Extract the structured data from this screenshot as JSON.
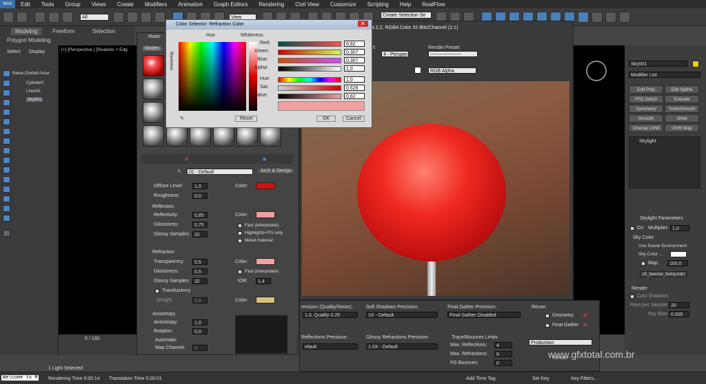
{
  "menubar": {
    "app_logo": "MAX",
    "items": [
      "Edit",
      "Tools",
      "Group",
      "Views",
      "Create",
      "Modifiers",
      "Animation",
      "Graph Editors",
      "Rendering",
      "Civil View",
      "Customize",
      "Scripting",
      "Help",
      "RealFlow"
    ]
  },
  "toolbar": {
    "selection_filter": "All",
    "ref_coord": "View",
    "named_selection": "Create Selection Se"
  },
  "ribbon": {
    "tabs": [
      "Modeling",
      "Freeform",
      "Selection"
    ],
    "subtitle": "Polygon Modeling"
  },
  "scene_explorer": {
    "tabs": [
      "Select",
      "Display"
    ],
    "header": "Name (Sorted Ascer",
    "items": [
      "Cylinder0",
      "Line001",
      "Sky001"
    ]
  },
  "viewport": {
    "label": "[+] [Perspective ] [Realistic + Edg"
  },
  "material_editor": {
    "title": "Mater",
    "menu": "Modes",
    "material_name": "01 - Default",
    "material_type": "Arch & Design",
    "main": {
      "diffuse_level_label": "Diffuse Level:",
      "diffuse_level": "1,0",
      "roughness_label": "Roughness:",
      "roughness": "0,0",
      "color_label": "Color:",
      "diffuse_color": "#d41010"
    },
    "reflection": {
      "title": "Reflection",
      "reflectivity_label": "Reflectivity:",
      "reflectivity": "0,85",
      "glossiness_label": "Glossiness:",
      "glossiness": "0,75",
      "samples_label": "Glossy Samples:",
      "samples": "32",
      "color_label": "Color:",
      "color": "#f0a0a0",
      "fast_label": "Fast (interpolate)",
      "highlights_label": "Highlights+FG only",
      "metal_label": "Metal material"
    },
    "refraction": {
      "title": "Refraction",
      "transparency_label": "Transparency:",
      "transparency": "0,5",
      "glossiness_label": "Glossiness:",
      "glossiness": "0,5",
      "samples_label": "Glossy Samples:",
      "samples": "32",
      "color_label": "Color:",
      "color": "#f0a0a0",
      "fast_label": "Fast (interpolate)",
      "ior_label": "IOR:",
      "ior": "1,4",
      "translucency_label": "Translucency",
      "weight_label": "Weight:",
      "weight": "0,5",
      "t_color": "#d8c080"
    },
    "anisotropy": {
      "title": "Anisotropy",
      "anisotropy_label": "Anisotropy:",
      "anisotropy": "1,0",
      "rotation_label": "Rotation:",
      "rotation": "0,0",
      "automatic_label": "Automatic",
      "map_channel_label": "Map Channel:",
      "map_channel": "0"
    }
  },
  "color_selector": {
    "title": "Color Selector: Refraction Color",
    "hue_label": "Hue",
    "whiteness_label": "Whiteness",
    "blackness_label": "Blackness",
    "channels": [
      {
        "label": "Red:",
        "value": "0,82"
      },
      {
        "label": "Green:",
        "value": "0,307"
      },
      {
        "label": "Blue:",
        "value": "0,307"
      },
      {
        "label": "Alpha:",
        "value": "1,0"
      },
      {
        "label": "Hue:",
        "value": "1,0"
      },
      {
        "label": "Sat:",
        "value": "0,626"
      },
      {
        "label": "Value:",
        "value": "0,82"
      }
    ],
    "reset": "Reset",
    "ok": "OK",
    "cancel": "Cancel",
    "preview_color": "#f0a0a0"
  },
  "render_window": {
    "title": "a 2,2, RGBA Color 32 Bits/Channel (1:1)",
    "viewport_label": "ort:",
    "viewport_value": "4 - Perspec",
    "preset_label": "Render Preset:",
    "preset_value": "-------------------",
    "channel": "RGB Alpha"
  },
  "render_settings": {
    "precision_label": "recision (Quality/Noise):",
    "precision_value": "1.0, Quality 0.25",
    "soft_shadows_label": "Soft Shadows Precision:",
    "soft_shadows_value": "1X - Default",
    "fg_label": "Final Gather Precision:",
    "fg_value": "Final Gather Disabled",
    "refl_label": "Reflections Precision:",
    "refl_value": "efault",
    "glossy_refr_label": "Glossy Refractions Precision:",
    "glossy_refr_value": "1.0X - Default",
    "trace_title": "Trace/Bounces Limits",
    "max_refl_label": "Max. Reflections:",
    "max_refl": "4",
    "max_refr_label": "Max. Refractions:",
    "max_refr": "6",
    "fg_bounces_label": "FG Bounces:",
    "fg_bounces": "0",
    "reuse_label": "Reuse",
    "geometry_label": "Geometry",
    "final_gather_label": "Final Gather",
    "mode": "Production",
    "render_btn": "Render"
  },
  "command_panel": {
    "object_name": "Sky001",
    "modifier_list": "Modifier List",
    "modifiers": [
      "Edit Poly",
      "Edit Spline",
      "FFD 3x3x3",
      "Extrude",
      "Symmetry",
      "TurboSmooth",
      "Smooth",
      "Shell",
      "Unwrap UVW",
      "UVW Map"
    ],
    "stack_item": "Skylight",
    "params": {
      "title": "Skylight Parameters",
      "on_label": "On",
      "multiplier_label": "Multiplier:",
      "multiplier": "1,0",
      "sky_color_label": "Sky Color",
      "scene_env_label": "Use Scene Environment",
      "sky_color_opt": "Sky Color ...",
      "map_label": "Map:",
      "map_value": "100,0",
      "map_file": "15_beerse_living.hdr)"
    },
    "render": {
      "title": "Render",
      "cast_shadows": "Cast Shadows",
      "rays_label": "Rays per Sample:",
      "rays": "20",
      "ray_bias_label": "Ray Bias:",
      "ray_bias": "0,005"
    }
  },
  "timeline": {
    "frame": "0 / 100"
  },
  "status": {
    "welcome": "Welcome to M",
    "selection": "1 Light Selected",
    "rendering_time": "Rendering Time  0:00:14",
    "translation_time": "Translation Time  0:00:01",
    "add_time_tag": "Add Time Tag",
    "set_key": "Set Key",
    "key_filters": "Key Filters..."
  },
  "watermark": "www.gfxtotal.com.br"
}
